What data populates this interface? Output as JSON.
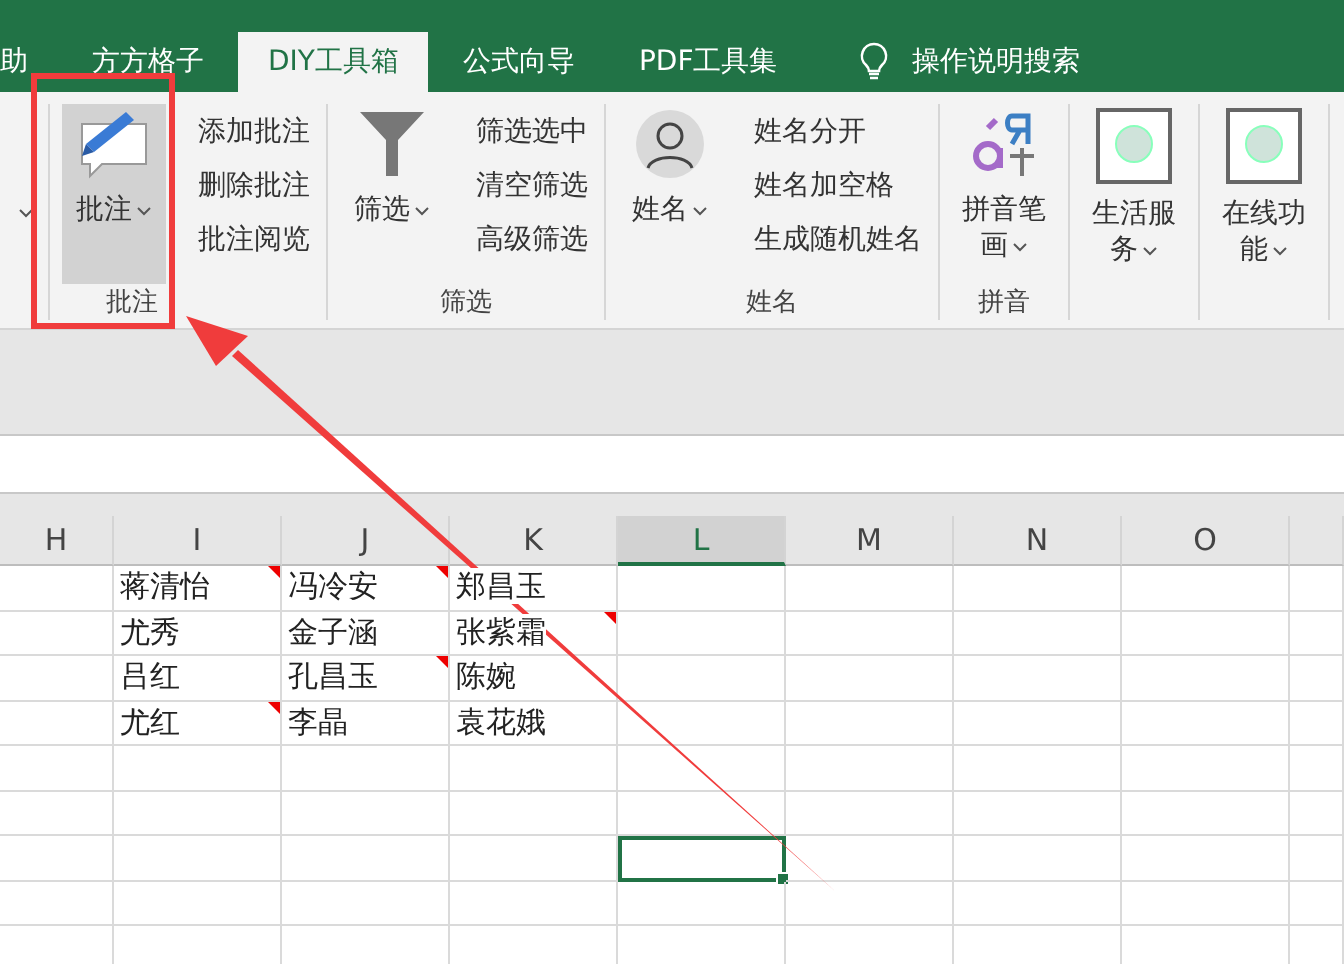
{
  "tabs": [
    {
      "label": "助",
      "selected": false
    },
    {
      "label": "方方格子",
      "selected": false
    },
    {
      "label": "DIY工具箱",
      "selected": true
    },
    {
      "label": "公式向导",
      "selected": false
    },
    {
      "label": "PDF工具集",
      "selected": false
    }
  ],
  "search": {
    "label": "操作说明搜索"
  },
  "ribbon": [
    {
      "kind": "partial"
    },
    {
      "kind": "group",
      "label": "批注",
      "big": {
        "label": "批注",
        "pressed": true
      },
      "items": [
        "添加批注",
        "删除批注",
        "批注阅览"
      ]
    },
    {
      "kind": "group",
      "label": "筛选",
      "big": {
        "label": "筛选",
        "pressed": false
      },
      "items": [
        "筛选选中",
        "清空筛选",
        "高级筛选"
      ]
    },
    {
      "kind": "group",
      "label": "姓名",
      "big": {
        "label": "姓名",
        "pressed": false
      },
      "items": [
        "姓名分开",
        "姓名加空格",
        "生成随机姓名"
      ]
    },
    {
      "kind": "group",
      "label": "拼音",
      "big": {
        "label": "拼音笔画",
        "pressed": false
      }
    },
    {
      "kind": "single",
      "big": {
        "label": "生活服务",
        "pressed": false
      }
    },
    {
      "kind": "single",
      "big": {
        "label": "在线功能",
        "pressed": false
      }
    }
  ],
  "columns": [
    {
      "label": "H",
      "selected": false
    },
    {
      "label": "I",
      "selected": false
    },
    {
      "label": "J",
      "selected": false
    },
    {
      "label": "K",
      "selected": false
    },
    {
      "label": "L",
      "selected": true
    },
    {
      "label": "M",
      "selected": false
    },
    {
      "label": "N",
      "selected": false
    },
    {
      "label": "O",
      "selected": false
    },
    {
      "selected": false
    }
  ],
  "rows": [
    {
      "cells": [
        {},
        {
          "text": "蒋清怡",
          "comment": true
        },
        {
          "text": "冯冷安",
          "comment": true
        },
        {
          "text": "郑昌玉",
          "comment": false
        },
        {},
        {},
        {},
        {},
        {}
      ]
    },
    {
      "cells": [
        {},
        {
          "text": "尤秀",
          "comment": false
        },
        {
          "text": "金子涵",
          "comment": false
        },
        {
          "text": "张紫霜",
          "comment": true
        },
        {},
        {},
        {},
        {},
        {}
      ]
    },
    {
      "cells": [
        {},
        {
          "text": "吕红",
          "comment": false
        },
        {
          "text": "孔昌玉",
          "comment": true
        },
        {
          "text": "陈婉",
          "comment": false
        },
        {},
        {},
        {},
        {},
        {}
      ]
    },
    {
      "cells": [
        {},
        {
          "text": "尤红",
          "comment": true
        },
        {
          "text": "李晶",
          "comment": false
        },
        {
          "text": "袁花娥",
          "comment": false
        },
        {},
        {},
        {},
        {},
        {}
      ]
    },
    {
      "cells": [
        {},
        {},
        {},
        {},
        {},
        {},
        {},
        {},
        {}
      ]
    },
    {
      "cells": [
        {},
        {},
        {},
        {},
        {},
        {},
        {},
        {},
        {}
      ]
    },
    {
      "cells": [
        {},
        {},
        {},
        {},
        {
          "selected": true
        },
        {},
        {},
        {},
        {}
      ]
    },
    {
      "cells": [
        {},
        {},
        {},
        {},
        {},
        {},
        {},
        {},
        {}
      ]
    },
    {
      "cells": [
        {},
        {},
        {},
        {},
        {},
        {},
        {},
        {},
        {}
      ]
    }
  ]
}
